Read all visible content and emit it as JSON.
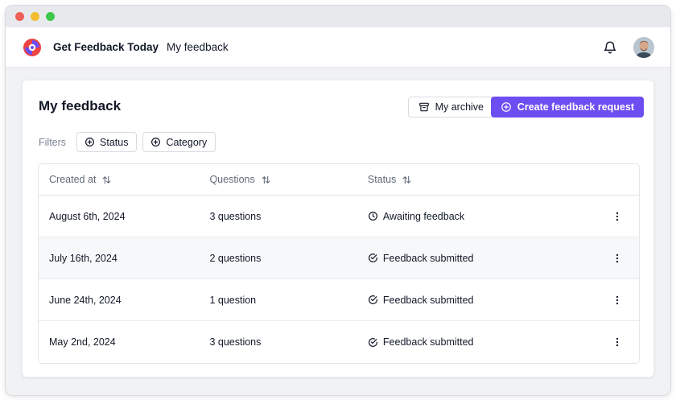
{
  "window": {
    "controls": [
      "close",
      "minimize",
      "maximize"
    ],
    "colors": {
      "close": "#ee5f57",
      "minimize": "#f4bd31",
      "maximize": "#3ec84a"
    }
  },
  "appbar": {
    "brand": "Get Feedback Today",
    "breadcrumb": "My feedback",
    "icons": {
      "logo": "brand-logo",
      "notifications": "bell-icon",
      "avatar": "user-avatar"
    }
  },
  "page": {
    "title": "My feedback",
    "archive_label": "My archive",
    "create_label": "Create feedback request",
    "accent": "#6c4ef2"
  },
  "filters": {
    "label": "Filters",
    "chips": [
      {
        "label": "Status",
        "icon": "plus-circle-icon"
      },
      {
        "label": "Category",
        "icon": "plus-circle-icon"
      }
    ]
  },
  "table": {
    "columns": [
      {
        "label": "Created at",
        "icon": "sort-icon"
      },
      {
        "label": "Questions",
        "icon": "sort-icon"
      },
      {
        "label": "Status",
        "icon": "sort-icon"
      }
    ],
    "rows": [
      {
        "created_at": "August 6th, 2024",
        "questions": "3 questions",
        "status": "Awaiting feedback",
        "status_icon": "clock-icon"
      },
      {
        "created_at": "July 16th, 2024",
        "questions": "2 questions",
        "status": "Feedback submitted",
        "status_icon": "check-circle-icon"
      },
      {
        "created_at": "June 24th, 2024",
        "questions": "1 question",
        "status": "Feedback submitted",
        "status_icon": "check-circle-icon"
      },
      {
        "created_at": "May 2nd, 2024",
        "questions": "3 questions",
        "status": "Feedback submitted",
        "status_icon": "check-circle-icon"
      }
    ]
  }
}
